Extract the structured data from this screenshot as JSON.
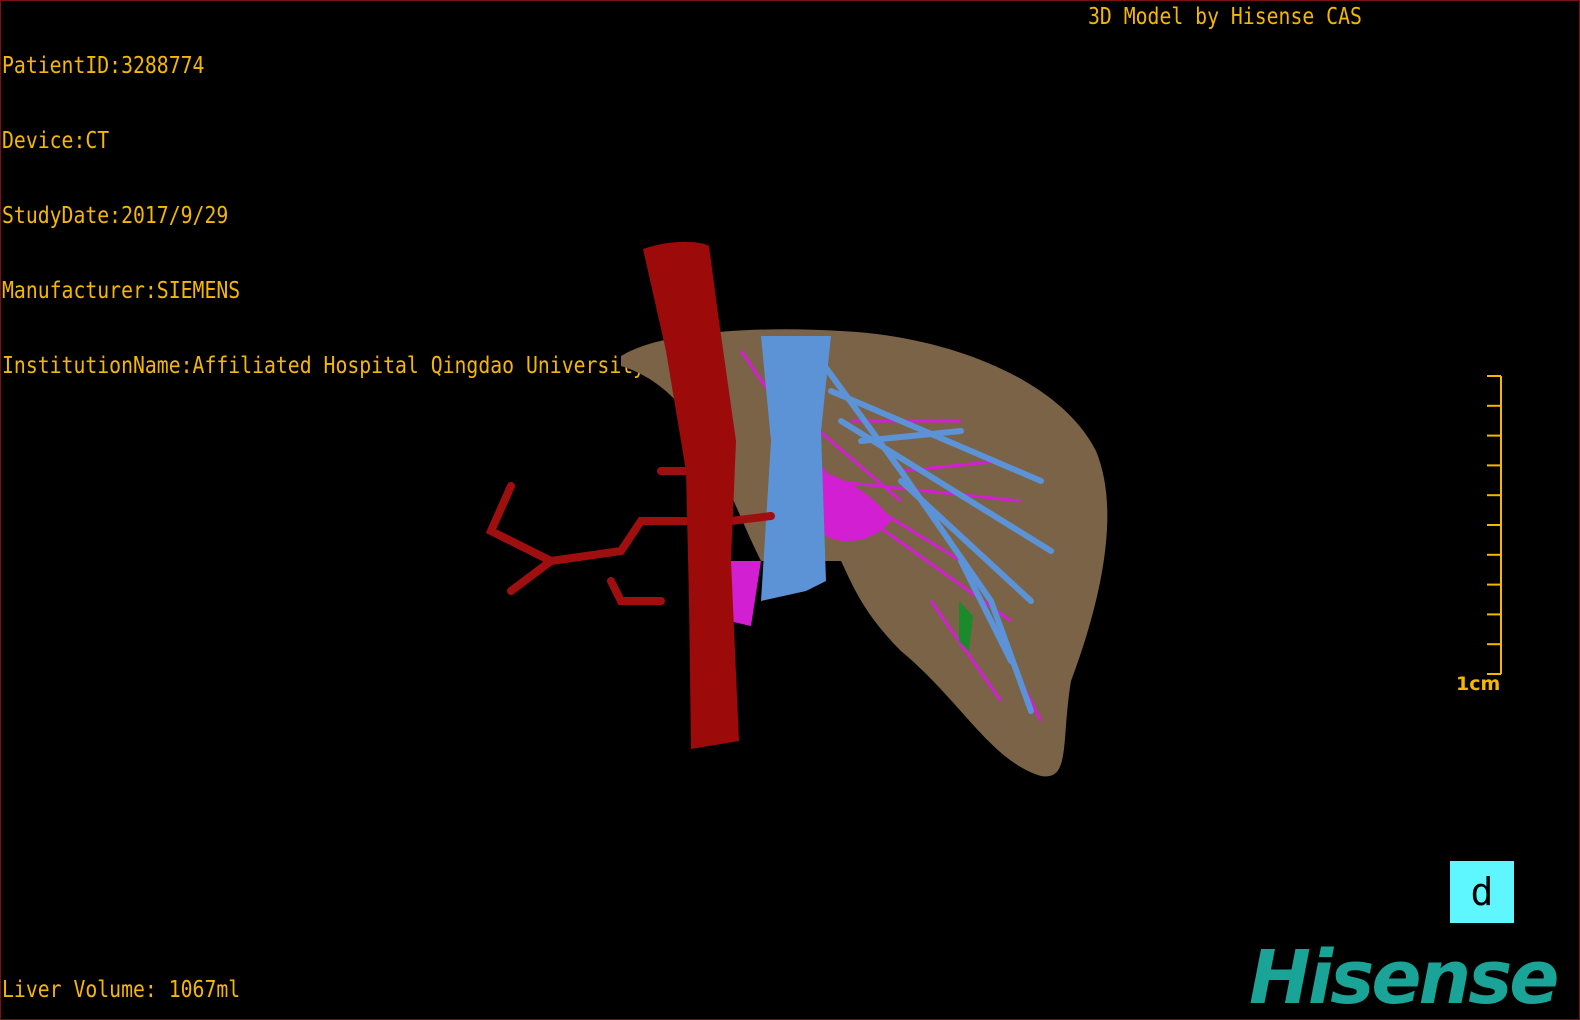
{
  "info": {
    "lines": [
      "PatientID:3288774",
      "Device:CT",
      "StudyDate:2017/9/29",
      "Manufacturer:SIEMENS",
      "InstitutionName:Affiliated Hospital Qingdao University-C"
    ]
  },
  "title": "3D Model by Hisense CAS",
  "volume": "Liver Volume: 1067ml",
  "scale": {
    "unit_label": "1cm",
    "ticks": 11
  },
  "orientation_label": "d",
  "logo": "Hisense",
  "colors": {
    "overlay_text": "#f5b800",
    "liver": "#7a6347",
    "aorta": "#9c0a0a",
    "portal_vein": "#5b93d6",
    "hepatic_vessels": "#d21fd2",
    "orientation_box": "#5ff7ff",
    "logo": "#1aa497",
    "border": "#7a1010"
  }
}
